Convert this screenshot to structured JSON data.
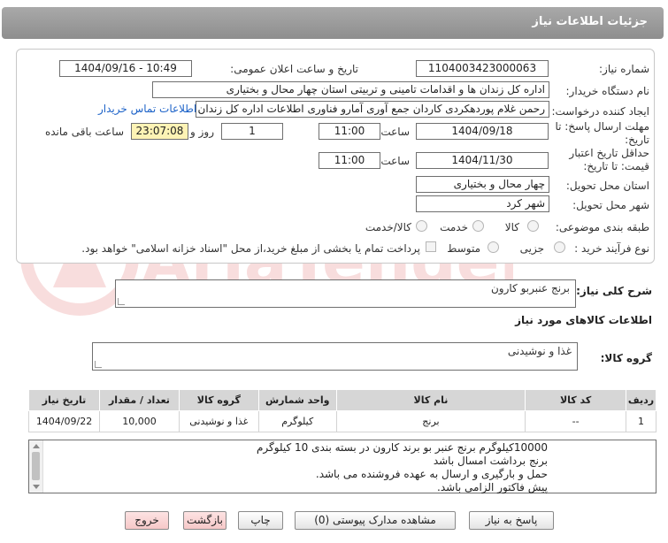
{
  "title": "جزئیات اطلاعات نیاز",
  "fields": {
    "need_number_label": "شماره نیاز:",
    "need_number": "1104003423000063",
    "announce_label": "تاریخ و ساعت اعلان عمومی:",
    "announce_value": "1404/09/16 - 10:49",
    "buyer_org_label": "نام دستگاه خریدار:",
    "buyer_org": "اداره کل زندان ها و اقدامات تامینی و تربیتی استان چهار محال و بختیاری",
    "creator_label": "ایجاد کننده درخواست:",
    "creator": "رحمن غلام پوردهکردی کاردان جمع آوری آمارو فناوری اطلاعات اداره کل زندان ها",
    "contact_link": "اطلاعات تماس خریدار",
    "deadline_label": "مهلت ارسال پاسخ: تا تاریخ:",
    "deadline_date": "1404/09/18",
    "time_label": "ساعت",
    "deadline_time": "11:00",
    "days_value": "1",
    "days_label": "روز و",
    "remaining_time": "23:07:08",
    "remaining_label": "ساعت باقی مانده",
    "validity_label": "حداقل تاریخ اعتبار قیمت: تا تاریخ:",
    "validity_date": "1404/11/30",
    "validity_time": "11:00",
    "province_label": "استان محل تحویل:",
    "province": "چهار محال و بختیاری",
    "city_label": "شهر محل تحویل:",
    "city": "شهر کرد",
    "category_label": "طبقه بندی موضوعی:",
    "category_options": [
      "کالا",
      "خدمت",
      "کالا/خدمت"
    ],
    "process_label": "نوع فرآیند خرید :",
    "process_options": [
      "جزیی",
      "متوسط"
    ],
    "payment_note": "پرداخت تمام یا بخشی از مبلغ خرید،از محل \"اسناد خزانه اسلامی\" خواهد بود."
  },
  "summary_label": "شرح کلی نیاز:",
  "summary": "برنج عنبربو کارون",
  "goods_info_title": "اطلاعات کالاهای مورد نیاز",
  "goods_group_label": "گروه کالا:",
  "goods_group": "غذا و نوشیدنی",
  "table": {
    "headers": [
      "ردیف",
      "کد کالا",
      "نام کالا",
      "واحد شمارش",
      "گروه کالا",
      "تعداد / مقدار",
      "تاریخ نیاز"
    ],
    "rows": [
      [
        "1",
        "--",
        "برنج",
        "کیلوگرم",
        "غذا و نوشیدنی",
        "10,000",
        "1404/09/22"
      ]
    ]
  },
  "notes_label": "توضیحات خریدار:",
  "notes_lines": [
    "10000کیلوگرم برنج عنبر بو برند کارون در بسته بندی 10 کیلوگرم",
    "برنج برداشت امسال باشد",
    "حمل و بارگیری و ارسال به عهده فروشنده می باشد.",
    "پیش فاکتور الزامی باشد."
  ],
  "buttons": {
    "reply": "پاسخ به نیاز",
    "docs": "مشاهده مدارک پیوستی (0)",
    "print": "چاپ",
    "back": "بازگشت",
    "exit": "خروج"
  },
  "watermark_text": "AriaTender.net",
  "colors": {
    "link": "#1c62c8",
    "highlight": "#fdf3b5",
    "header_bar": "#9a9a9a"
  }
}
